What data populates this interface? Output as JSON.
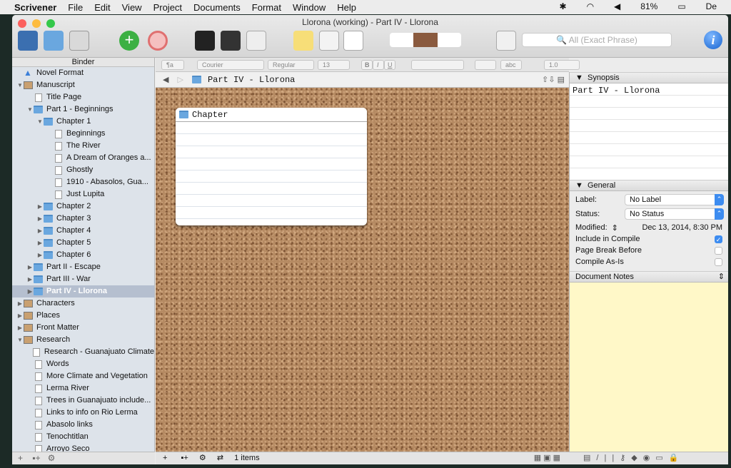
{
  "menubar": {
    "app": "Scrivener",
    "items": [
      "File",
      "Edit",
      "View",
      "Project",
      "Documents",
      "Format",
      "Window",
      "Help"
    ],
    "battery": "81%",
    "clock": "De"
  },
  "window": {
    "title": "Llorona (working) - Part IV - Llorona"
  },
  "toolbar": {
    "search_placeholder": "All (Exact Phrase)",
    "info": "i"
  },
  "binder": {
    "header": "Binder",
    "items": [
      {
        "label": "Novel Format",
        "level": 0,
        "icon": "warning-icon",
        "tri": ""
      },
      {
        "label": "Manuscript",
        "level": 0,
        "icon": "manuscript-icon",
        "tri": "▼"
      },
      {
        "label": "Title Page",
        "level": 1,
        "icon": "doc-icon",
        "tri": ""
      },
      {
        "label": "Part 1 - Beginnings",
        "level": 1,
        "icon": "folder-icon",
        "tri": "▼"
      },
      {
        "label": "Chapter 1",
        "level": 2,
        "icon": "folder-icon",
        "tri": "▼"
      },
      {
        "label": "Beginnings",
        "level": 3,
        "icon": "doc-icon",
        "tri": ""
      },
      {
        "label": "The River",
        "level": 3,
        "icon": "doc-icon",
        "tri": ""
      },
      {
        "label": "A Dream of Oranges a...",
        "level": 3,
        "icon": "doc-icon",
        "tri": ""
      },
      {
        "label": "Ghostly",
        "level": 3,
        "icon": "doc-icon",
        "tri": ""
      },
      {
        "label": "1910 - Abasolos, Guа...",
        "level": 3,
        "icon": "doc-icon",
        "tri": ""
      },
      {
        "label": "Just Lupita",
        "level": 3,
        "icon": "doc-icon",
        "tri": ""
      },
      {
        "label": "Chapter 2",
        "level": 2,
        "icon": "folder-icon",
        "tri": "▶"
      },
      {
        "label": "Chapter 3",
        "level": 2,
        "icon": "folder-icon",
        "tri": "▶"
      },
      {
        "label": "Chapter 4",
        "level": 2,
        "icon": "folder-icon",
        "tri": "▶"
      },
      {
        "label": "Chapter 5",
        "level": 2,
        "icon": "folder-icon",
        "tri": "▶"
      },
      {
        "label": "Chapter 6",
        "level": 2,
        "icon": "folder-icon",
        "tri": "▶"
      },
      {
        "label": "Part II - Escape",
        "level": 1,
        "icon": "folder-icon",
        "tri": "▶"
      },
      {
        "label": "Part III - War",
        "level": 1,
        "icon": "folder-icon",
        "tri": "▶"
      },
      {
        "label": "Part IV - Llorona",
        "level": 1,
        "icon": "folder-icon",
        "tri": "▶",
        "selected": true
      },
      {
        "label": "Characters",
        "level": 0,
        "icon": "characters-icon",
        "tri": "▶"
      },
      {
        "label": "Places",
        "level": 0,
        "icon": "places-icon",
        "tri": "▶"
      },
      {
        "label": "Front Matter",
        "level": 0,
        "icon": "front-matter-icon",
        "tri": "▶"
      },
      {
        "label": "Research",
        "level": 0,
        "icon": "research-icon",
        "tri": "▼"
      },
      {
        "label": "Research - Guanajuato Climate",
        "level": 1,
        "icon": "doc-icon",
        "tri": ""
      },
      {
        "label": "Words",
        "level": 1,
        "icon": "doc-icon",
        "tri": ""
      },
      {
        "label": "More Climate and Vegetation",
        "level": 1,
        "icon": "doc-icon",
        "tri": ""
      },
      {
        "label": "Lerma River",
        "level": 1,
        "icon": "doc-icon",
        "tri": ""
      },
      {
        "label": "Trees in Guanajuato include...",
        "level": 1,
        "icon": "doc-icon",
        "tri": ""
      },
      {
        "label": "Links to info on Rio Lerma",
        "level": 1,
        "icon": "doc-icon",
        "tri": ""
      },
      {
        "label": "Abasolo links",
        "level": 1,
        "icon": "doc-icon",
        "tri": ""
      },
      {
        "label": "Tenochtitlan",
        "level": 1,
        "icon": "doc-icon",
        "tri": ""
      },
      {
        "label": "Arroyo Seco",
        "level": 1,
        "icon": "doc-icon",
        "tri": ""
      }
    ]
  },
  "format_bar": {
    "style": "¶a",
    "font": "Courier",
    "weight": "Regular",
    "size": "13",
    "bold": "B",
    "italic": "I",
    "underline": "U",
    "highlight": "abc",
    "line_spacing": "1.0",
    "list": "☰"
  },
  "editor": {
    "header_title": "Part IV - Llorona",
    "card_title": "Chapter",
    "items_count": "1 items"
  },
  "inspector": {
    "synopsis_header": "Synopsis",
    "synopsis_text": "Part IV - Llorona",
    "general_header": "General",
    "label_label": "Label:",
    "label_value": "No Label",
    "status_label": "Status:",
    "status_value": "No Status",
    "modified_label": "Modified:",
    "modified_value": "Dec 13, 2014, 8:30 PM",
    "include_compile": "Include in Compile",
    "include_compile_checked": true,
    "page_break": "Page Break Before",
    "page_break_checked": false,
    "compile_as_is": "Compile As-Is",
    "compile_as_is_checked": false,
    "notes_header": "Document Notes"
  }
}
